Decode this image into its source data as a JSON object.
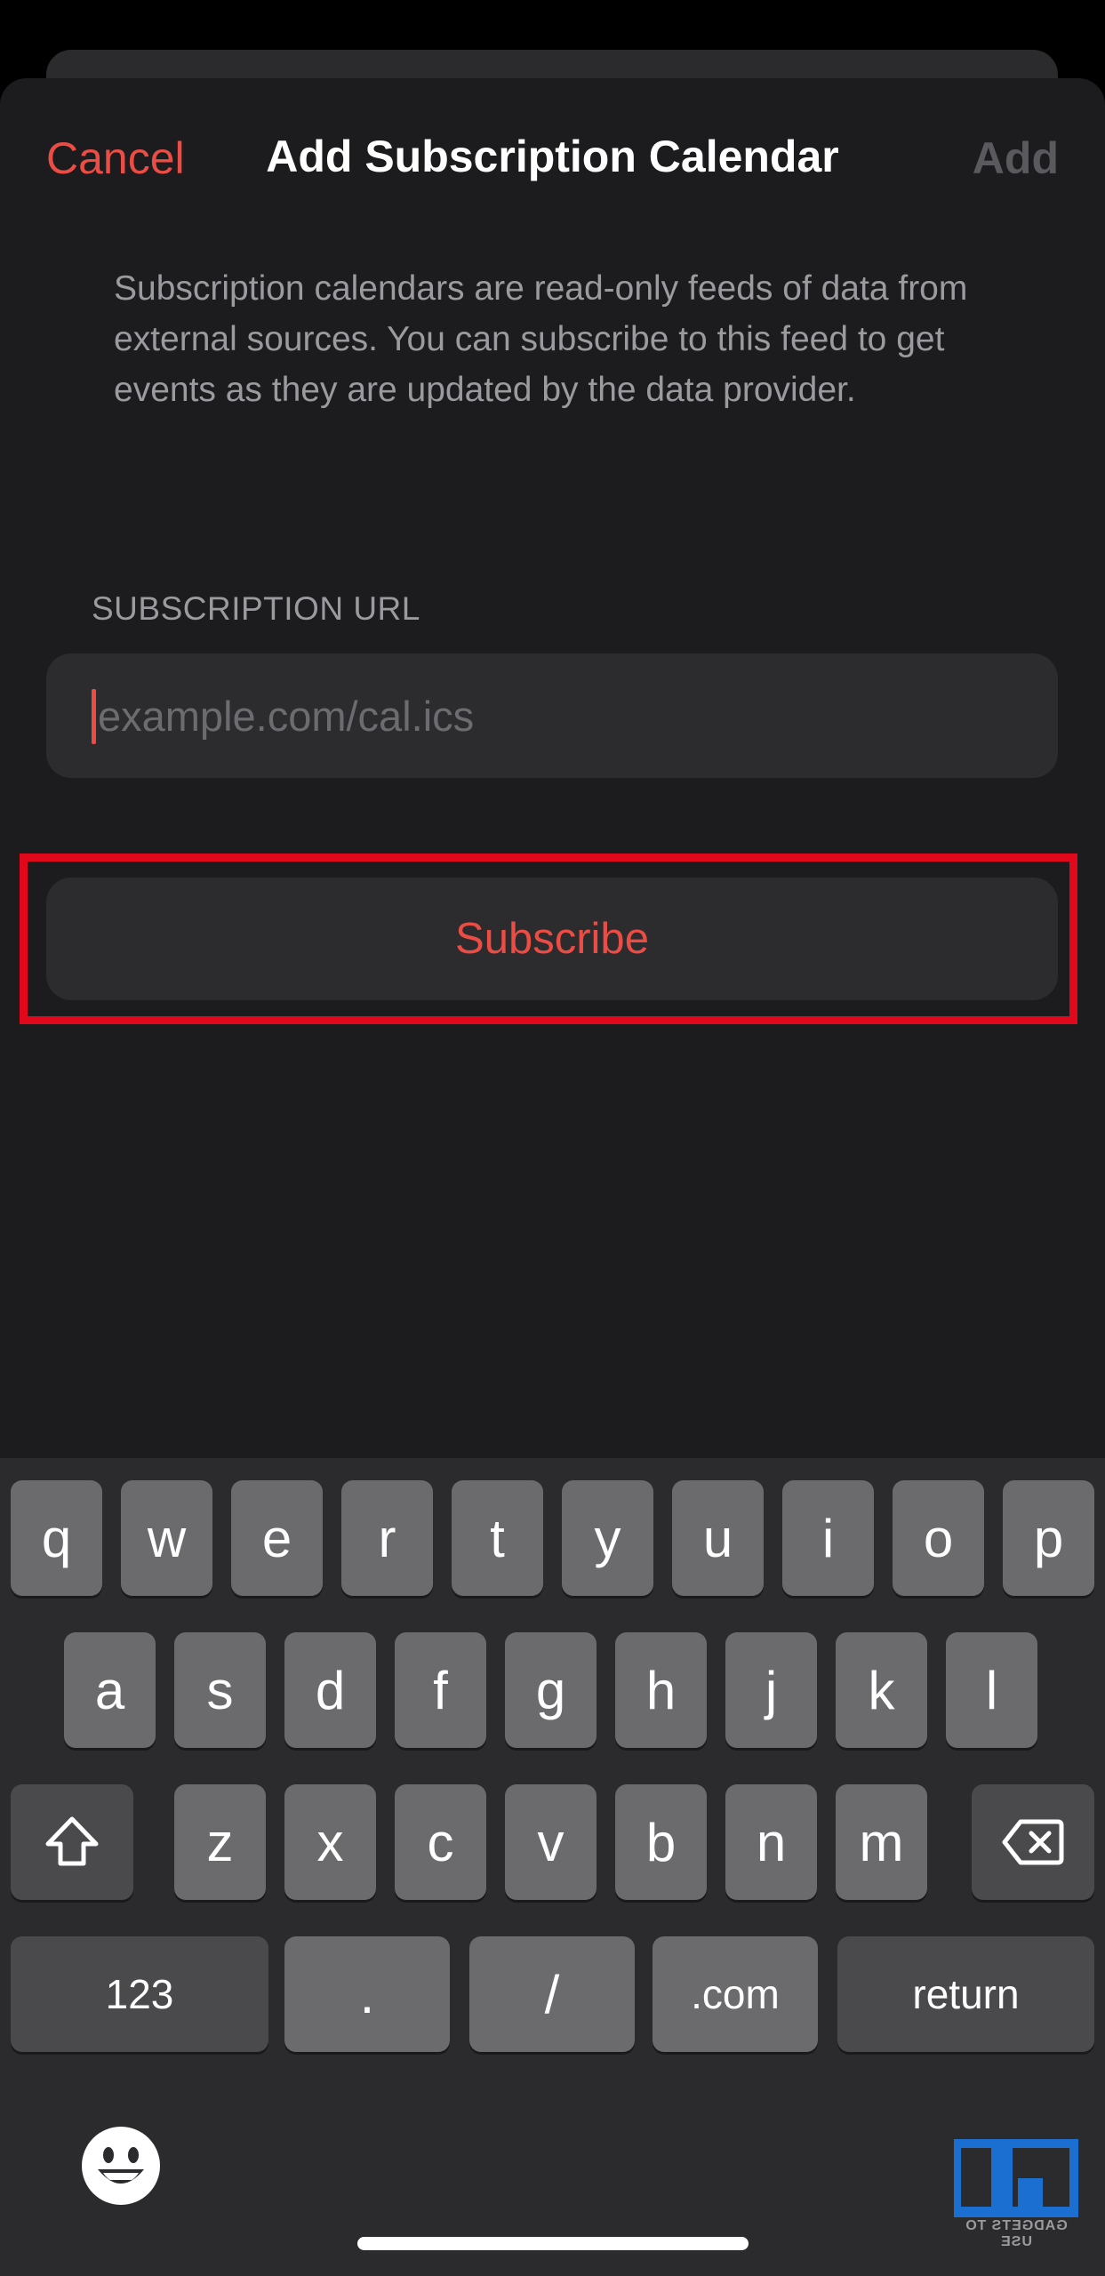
{
  "nav": {
    "cancel_label": "Cancel",
    "title": "Add Subscription Calendar",
    "add_label": "Add"
  },
  "description": "Subscription calendars are read-only feeds of data from external sources. You can subscribe to this feed to get events as they are updated by the data provider.",
  "subscription_url": {
    "section_label": "SUBSCRIPTION URL",
    "placeholder": "example.com/cal.ics",
    "value": ""
  },
  "subscribe_label": "Subscribe",
  "keyboard": {
    "row1": [
      "q",
      "w",
      "e",
      "r",
      "t",
      "y",
      "u",
      "i",
      "o",
      "p"
    ],
    "row2": [
      "a",
      "s",
      "d",
      "f",
      "g",
      "h",
      "j",
      "k",
      "l"
    ],
    "row3": [
      "z",
      "x",
      "c",
      "v",
      "b",
      "n",
      "m"
    ],
    "bottom": {
      "numbers_label": "123",
      "dot_label": ".",
      "slash_label": "/",
      "dotcom_label": ".com",
      "return_label": "return"
    },
    "icons": {
      "shift": "shift-icon",
      "delete": "delete-icon",
      "emoji": "emoji-icon"
    }
  },
  "watermark": {
    "text": "GADGETS TO USE"
  },
  "colors": {
    "accent": "#eb4d45",
    "sheet_background": "#1c1c1e",
    "field_background": "#2c2c2e",
    "highlight_border": "#e0081a",
    "key_light": "#6b6b6e",
    "key_dark": "#4a4a4c"
  }
}
